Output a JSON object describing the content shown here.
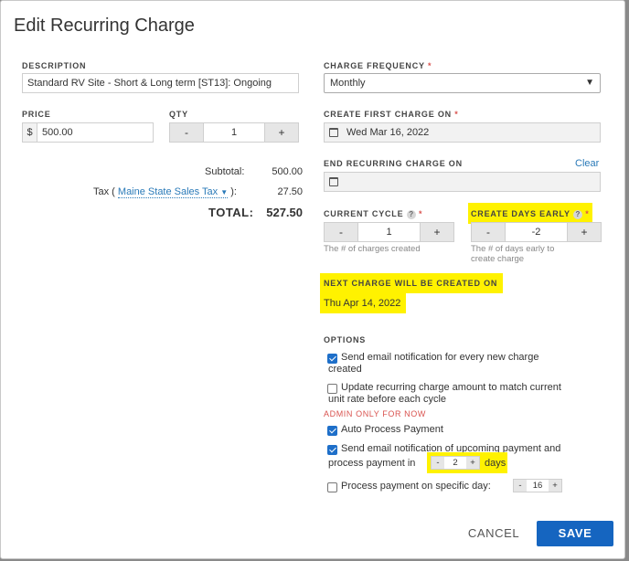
{
  "dialog": {
    "title": "Edit Recurring Charge"
  },
  "description": {
    "label": "DESCRIPTION",
    "value": "Standard RV Site - Short & Long term [ST13]: Ongoing"
  },
  "price": {
    "label": "PRICE",
    "currency": "$",
    "value": "500.00"
  },
  "qty": {
    "label": "QTY",
    "value": "1",
    "minus": "-",
    "plus": "+"
  },
  "totals": {
    "subtotal_label": "Subtotal:",
    "subtotal_value": "500.00",
    "tax_prefix": "Tax (",
    "tax_name": "Maine State Sales Tax",
    "tax_suffix": "):",
    "tax_value": "27.50",
    "total_label": "TOTAL:",
    "total_value": "527.50"
  },
  "frequency": {
    "label": "CHARGE FREQUENCY",
    "required": "*",
    "value": "Monthly"
  },
  "first_charge": {
    "label": "CREATE FIRST CHARGE ON",
    "required": "*",
    "value": "Wed Mar 16, 2022"
  },
  "end_charge": {
    "label": "END RECURRING CHARGE ON",
    "clear": "Clear",
    "value": ""
  },
  "current_cycle": {
    "label": "CURRENT CYCLE",
    "required": "*",
    "value": "1",
    "minus": "-",
    "plus": "+",
    "hint": "The # of charges created"
  },
  "days_early": {
    "label": "CREATE DAYS EARLY",
    "required": "*",
    "value": "-2",
    "minus": "-",
    "plus": "+",
    "hint_line1": "The # of days early to",
    "hint_line2": "create charge"
  },
  "next_charge": {
    "label": "NEXT CHARGE WILL BE CREATED ON",
    "value": "Thu Apr 14, 2022"
  },
  "options": {
    "label": "OPTIONS",
    "send_email_new": {
      "checked": true,
      "line1": "Send email notification for every new charge",
      "line2": "created"
    },
    "update_amount": {
      "checked": false,
      "line1": "Update recurring charge amount to match current",
      "line2": "unit rate before each cycle"
    },
    "admin_only": "ADMIN ONLY FOR NOW",
    "auto_process": {
      "checked": true,
      "text": "Auto Process Payment"
    },
    "send_email_upcoming": {
      "checked": true,
      "line1": "Send email notification of upcoming payment and",
      "line2_prefix": "process payment in",
      "days_value": "2",
      "minus": "-",
      "plus": "+",
      "days_suffix": "days"
    },
    "process_specific_day": {
      "checked": false,
      "text": "Process payment on specific day:",
      "day_value": "16",
      "minus": "-",
      "plus": "+"
    }
  },
  "footer": {
    "cancel": "CANCEL",
    "save": "SAVE"
  },
  "colors": {
    "primary": "#1565c0",
    "highlight": "#fff200",
    "required": "#d9534f",
    "link": "#2a7ab8"
  },
  "icons": {
    "calendar": "calendar-icon",
    "help": "help-icon",
    "dropdown": "chevron-down-icon"
  }
}
